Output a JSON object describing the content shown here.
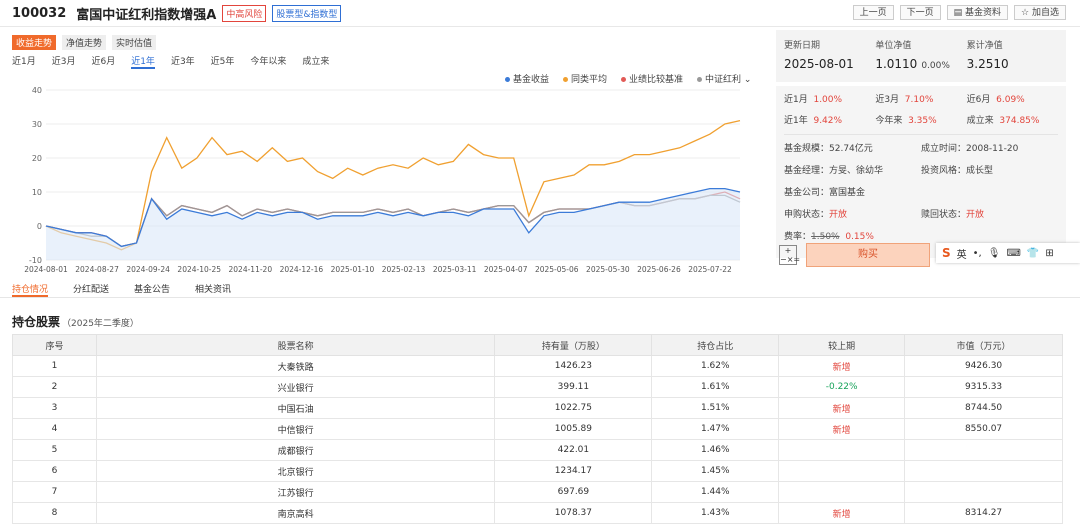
{
  "header": {
    "code": "100032",
    "name": "富国中证红利指数增强A",
    "risk_tag": "中高风险",
    "type_tag": "股票型&指数型",
    "buttons": [
      "上一页",
      "下一页",
      "基金资料",
      "加自选"
    ]
  },
  "chart_tabs": [
    "收益走势",
    "净值走势",
    "实时估值"
  ],
  "ranges": [
    "近1月",
    "近3月",
    "近6月",
    "近1年",
    "近3年",
    "近5年",
    "今年以来",
    "成立来"
  ],
  "legend": [
    {
      "name": "基金收益",
      "color": "#3b7bd8"
    },
    {
      "name": "同类平均",
      "color": "#f0a030"
    },
    {
      "name": "业绩比较基准",
      "color": "#e25a56"
    },
    {
      "name": "中证红利",
      "color": "#999999"
    }
  ],
  "chart_data": {
    "type": "line",
    "ylim": [
      -10,
      40
    ],
    "yticks": [
      40,
      30,
      20,
      10,
      0,
      -10
    ],
    "xticks": [
      "2024-08-01",
      "2024-08-27",
      "2024-09-24",
      "2024-10-25",
      "2024-11-20",
      "2024-12-16",
      "2025-01-10",
      "2025-02-13",
      "2025-03-11",
      "2025-04-07",
      "2025-05-06",
      "2025-05-30",
      "2025-06-26",
      "2025-07-22"
    ],
    "series": [
      {
        "name": "同类平均",
        "color": "#f0a030",
        "values": [
          0,
          -2,
          -3,
          -4,
          -5,
          -7,
          -5,
          16,
          26,
          17,
          20,
          26,
          21,
          22,
          19,
          23,
          19,
          20,
          16,
          14,
          17,
          15,
          17,
          18,
          17,
          20,
          18,
          19,
          24,
          21,
          20,
          20,
          3,
          13,
          14,
          15,
          18,
          18,
          19,
          21,
          21,
          22,
          23,
          25,
          27,
          30,
          31
        ]
      },
      {
        "name": "业绩比较基准",
        "color": "#e25a56",
        "values": [
          0,
          -1,
          -2,
          -2,
          -3,
          -6,
          -5,
          8,
          3,
          6,
          5,
          4,
          6,
          3,
          5,
          4,
          5,
          4,
          3,
          4,
          4,
          4,
          5,
          4,
          5,
          3,
          4,
          5,
          4,
          5,
          6,
          6,
          1,
          4,
          5,
          5,
          5,
          6,
          7,
          6,
          6,
          7,
          8,
          8,
          9,
          10,
          8
        ]
      },
      {
        "name": "中证红利",
        "color": "#999999",
        "values": [
          0,
          -1,
          -2,
          -3,
          -3,
          -6,
          -5,
          8,
          3,
          6,
          5,
          4,
          6,
          3,
          5,
          4,
          5,
          4,
          3,
          4,
          4,
          4,
          5,
          4,
          5,
          3,
          4,
          5,
          4,
          5,
          6,
          6,
          1,
          4,
          5,
          5,
          5,
          6,
          7,
          6,
          6,
          7,
          8,
          8,
          9,
          9,
          7
        ]
      },
      {
        "name": "基金收益",
        "color": "#3b7bd8",
        "values": [
          0,
          -1,
          -2,
          -2,
          -3,
          -6,
          -5,
          8,
          2,
          5,
          4,
          3,
          4,
          2,
          4,
          3,
          4,
          4,
          2,
          3,
          3,
          3,
          4,
          3,
          4,
          3,
          4,
          4,
          3,
          5,
          5,
          5,
          -2,
          3,
          4,
          4,
          5,
          6,
          7,
          7,
          7,
          8,
          9,
          10,
          11,
          11,
          10
        ]
      }
    ]
  },
  "nav": {
    "update_label": "更新日期",
    "update": "2025-08-01",
    "unit_label": "单位净值",
    "unit": "1.0110",
    "unit_chg": "0.00%",
    "acc_label": "累计净值",
    "acc": "3.2510"
  },
  "perf": [
    [
      {
        "k": "近1月",
        "v": "1.00%"
      },
      {
        "k": "近3月",
        "v": "7.10%"
      },
      {
        "k": "近6月",
        "v": "6.09%"
      }
    ],
    [
      {
        "k": "近1年",
        "v": "9.42%"
      },
      {
        "k": "今年来",
        "v": "3.35%"
      },
      {
        "k": "成立来",
        "v": "374.85%"
      }
    ]
  ],
  "details": [
    [
      {
        "k": "基金规模：",
        "v": "52.74亿元"
      },
      {
        "k": "成立时间：",
        "v": "2008-11-20"
      }
    ],
    [
      {
        "k": "基金经理：",
        "v": "方旻、徐幼华"
      },
      {
        "k": "投资风格：",
        "v": "成长型"
      }
    ],
    [
      {
        "k": "基金公司：",
        "v": "富国基金"
      },
      {
        "k": "",
        "v": ""
      }
    ]
  ],
  "status": {
    "buy_label": "申购状态：",
    "buy": "开放",
    "redeem_label": "赎回状态：",
    "redeem": "开放"
  },
  "fee": {
    "label": "费率：",
    "old": "1.50%",
    "new": "0.15%"
  },
  "buy_button": "购买",
  "ime": {
    "logo": "S",
    "lang": "英"
  },
  "calc_icon": "+−×=",
  "subtabs": [
    "持仓情况",
    "分红配送",
    "基金公告",
    "相关资讯"
  ],
  "holdings": {
    "title": "持仓股票",
    "period": "（2025年二季度）",
    "columns": [
      "序号",
      "股票名称",
      "持有量（万股）",
      "持仓占比",
      "较上期",
      "市值（万元）"
    ],
    "rows": [
      [
        "1",
        "大秦铁路",
        "1426.23",
        "1.62%",
        "新增",
        "9426.30"
      ],
      [
        "2",
        "兴业银行",
        "399.11",
        "1.61%",
        "-0.22%",
        "9315.33"
      ],
      [
        "3",
        "中国石油",
        "1022.75",
        "1.51%",
        "新增",
        "8744.50"
      ],
      [
        "4",
        "中信银行",
        "1005.89",
        "1.47%",
        "新增",
        "8550.07"
      ],
      [
        "5",
        "成都银行",
        "422.01",
        "1.46%",
        "",
        ""
      ],
      [
        "6",
        "北京银行",
        "1234.17",
        "1.45%",
        "",
        ""
      ],
      [
        "7",
        "江苏银行",
        "697.69",
        "1.44%",
        "",
        ""
      ],
      [
        "8",
        "南京高科",
        "1078.37",
        "1.43%",
        "新增",
        "8314.27"
      ]
    ]
  }
}
